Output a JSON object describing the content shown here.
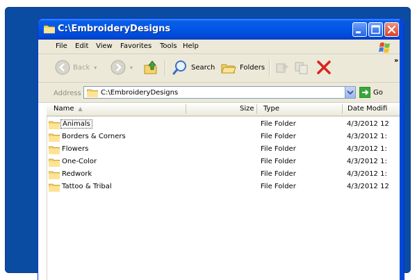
{
  "window": {
    "title": "C:\\EmbroideryDesigns",
    "accent": "#0058e6"
  },
  "menu": {
    "items": [
      "File",
      "Edit",
      "View",
      "Favorites",
      "Tools",
      "Help"
    ]
  },
  "toolbar": {
    "back_label": "Back",
    "search_label": "Search",
    "folders_label": "Folders"
  },
  "address": {
    "label": "Address",
    "value": "C:\\EmbroideryDesigns",
    "go_label": "Go"
  },
  "columns": {
    "name": "Name",
    "size": "Size",
    "type": "Type",
    "date": "Date Modifi"
  },
  "files": [
    {
      "name": "Animals",
      "type": "File Folder",
      "date": "4/3/2012 12"
    },
    {
      "name": "Borders & Corners",
      "type": "File Folder",
      "date": "4/3/2012 1:"
    },
    {
      "name": "Flowers",
      "type": "File Folder",
      "date": "4/3/2012 1:"
    },
    {
      "name": "One-Color",
      "type": "File Folder",
      "date": "4/3/2012 1:"
    },
    {
      "name": "Redwork",
      "type": "File Folder",
      "date": "4/3/2012 1:"
    },
    {
      "name": "Tattoo & Tribal",
      "type": "File Folder",
      "date": "4/3/2012 12"
    }
  ]
}
